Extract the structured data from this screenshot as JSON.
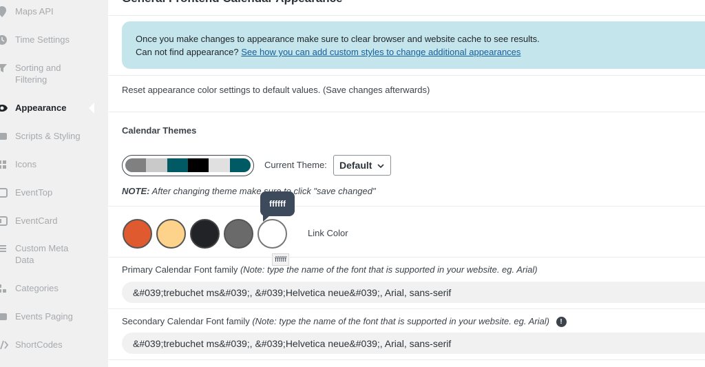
{
  "sidebar": {
    "items": [
      {
        "label": "Maps API",
        "icon": "map-pin-icon"
      },
      {
        "label": "Time Settings",
        "icon": "clock-icon"
      },
      {
        "label": "Sorting and Filtering",
        "icon": "filter-icon"
      },
      {
        "label": "Appearance",
        "icon": "eye-icon",
        "active": true
      },
      {
        "label": "Scripts & Styling",
        "icon": "code-icon"
      },
      {
        "label": "Icons",
        "icon": "grid-icon"
      },
      {
        "label": "EventTop",
        "icon": "calendar-top-icon"
      },
      {
        "label": "EventCard",
        "icon": "card-icon"
      },
      {
        "label": "Custom Meta Data",
        "icon": "list-icon"
      },
      {
        "label": "Categories",
        "icon": "tags-icon"
      },
      {
        "label": "Events Paging",
        "icon": "paging-icon"
      },
      {
        "label": "ShortCodes",
        "icon": "shortcode-icon"
      }
    ]
  },
  "main": {
    "title": "General Frontend Calendar Appearance",
    "notice": {
      "line1": "Once you make changes to appearance make sure to clear browser and website cache to see results.",
      "line2_prefix": "Can not find appearance?",
      "line2_link": "See how you can add custom styles to change additional appearances"
    },
    "reset_text": "Reset appearance color settings to default values. (Save changes afterwards)",
    "themes": {
      "title": "Calendar Themes",
      "swatch_colors": [
        "#808080",
        "#c9c9c9",
        "#005a64",
        "#000000",
        "#e0e0e0",
        "#005a64"
      ],
      "current_label": "Current Theme:",
      "current_value": "Default",
      "note_bold": "NOTE:",
      "note_text": "After changing theme make sure to click \"save changed\""
    },
    "colors": {
      "swatches": [
        "#e05a2f",
        "#fdd28a",
        "#222327",
        "#6a6a6a",
        "#ffffff"
      ],
      "tooltip": "ffffff",
      "hex_label": "ffffff",
      "link_label": "Link Color"
    },
    "fonts": {
      "primary_label": "Primary Calendar Font family",
      "primary_note": "(Note: type the name of the font that is supported in your website. eg. Arial)",
      "primary_value": "&#039;trebuchet ms&#039;, &#039;Helvetica neue&#039;, Arial, sans-serif",
      "secondary_label": "Secondary Calendar Font family",
      "secondary_note": "(Note: type the name of the font that is supported in your website. eg. Arial)",
      "secondary_value": "&#039;trebuchet ms&#039;, &#039;Helvetica neue&#039;, Arial, sans-serif",
      "info_glyph": "!"
    }
  }
}
